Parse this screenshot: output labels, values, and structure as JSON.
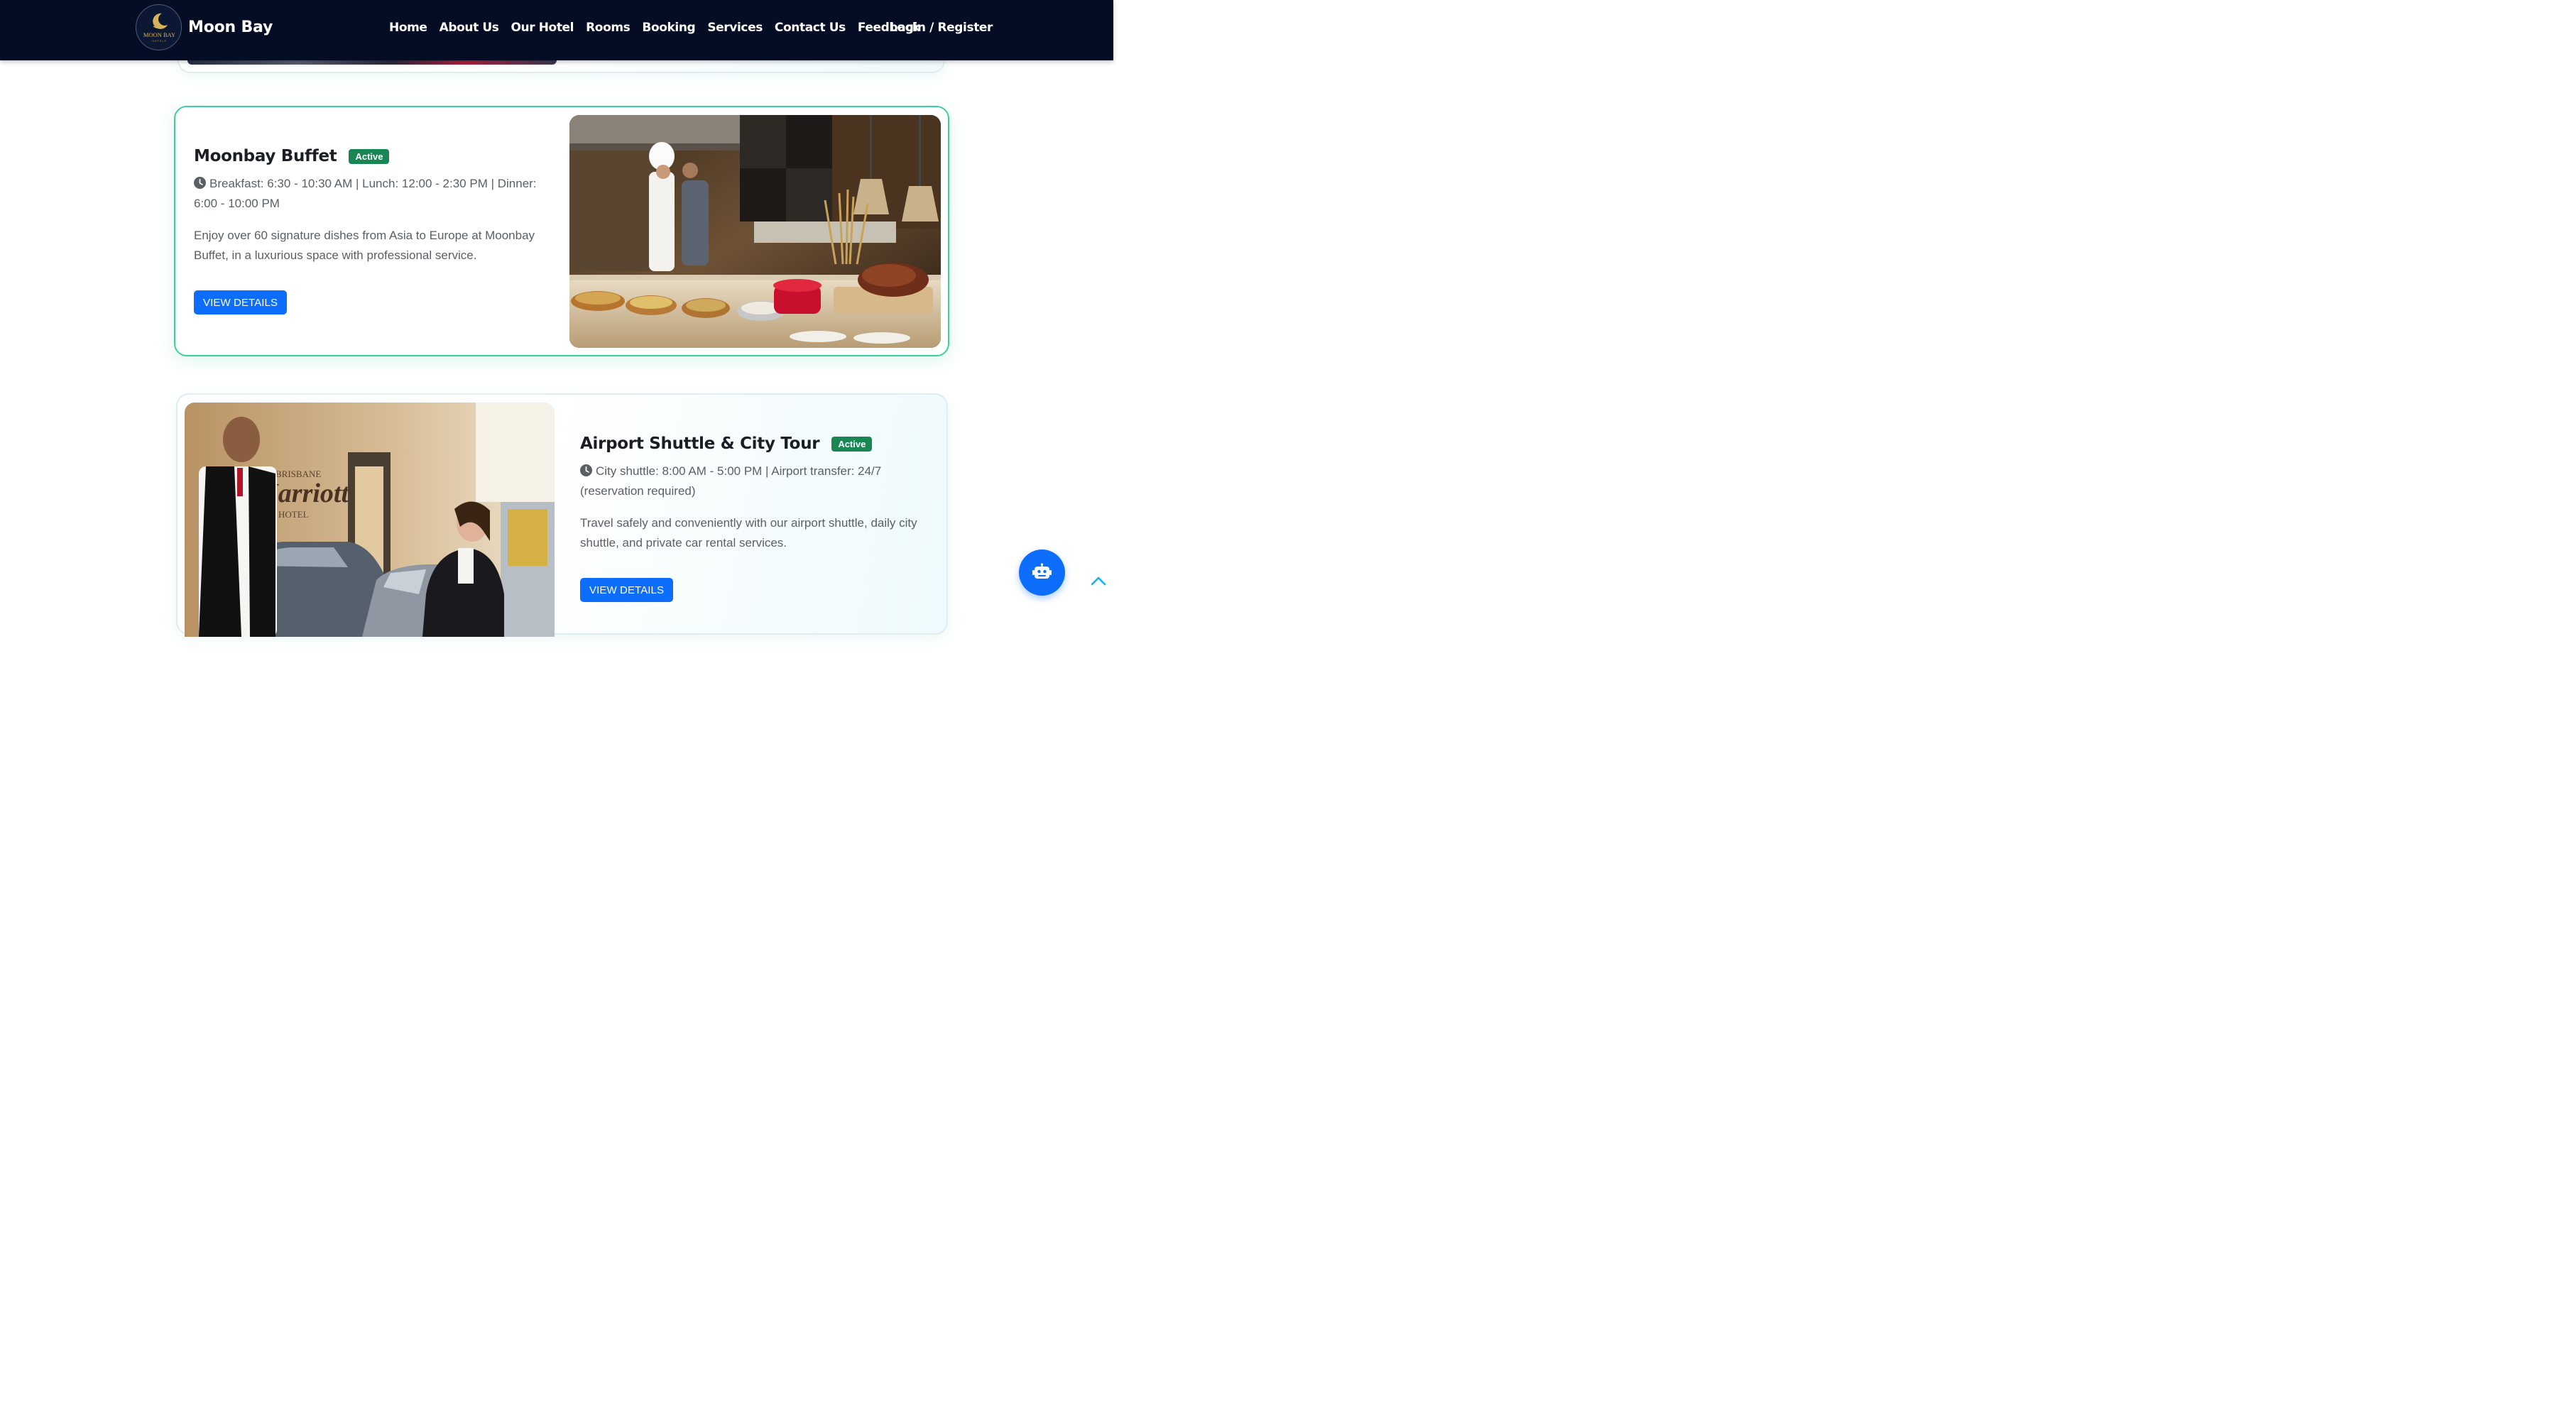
{
  "brand": {
    "name": "Moon Bay",
    "logo_text": "MOON BAY",
    "logo_subtext": "HOTELS"
  },
  "nav": {
    "links": [
      "Home",
      "About Us",
      "Our Hotel",
      "Rooms",
      "Booking",
      "Services",
      "Contact Us",
      "Feedback"
    ],
    "login": "Login / Register"
  },
  "services": [
    {
      "title": "Moonbay Buffet",
      "status": "Active",
      "hours": "Breakfast: 6:30 - 10:30 AM | Lunch: 12:00 - 2:30 PM | Dinner: 6:00 - 10:00 PM",
      "description": "Enjoy over 60 signature dishes from Asia to Europe at Moonbay Buffet, in a luxurious space with professional service.",
      "button": "VIEW DETAILS"
    },
    {
      "title": "Airport Shuttle & City Tour",
      "status": "Active",
      "hours": "City shuttle: 8:00 AM - 5:00 PM | Airport transfer: 24/7 (reservation required)",
      "description": "Travel safely and conveniently with our airport shuttle, daily city shuttle, and private car rental services.",
      "button": "VIEW DETAILS"
    }
  ],
  "photo_signage": {
    "line1": "BRISBANE",
    "line2": "Marriott",
    "line3": "HOTEL"
  },
  "colors": {
    "navbar": "#050d24",
    "accent": "#0d6efd",
    "badge": "#198754",
    "highlight_border": "#3ccf9e"
  },
  "icons": {
    "clock": "clock-icon",
    "chat": "robot-icon",
    "back_to_top": "chevron-up-icon"
  }
}
